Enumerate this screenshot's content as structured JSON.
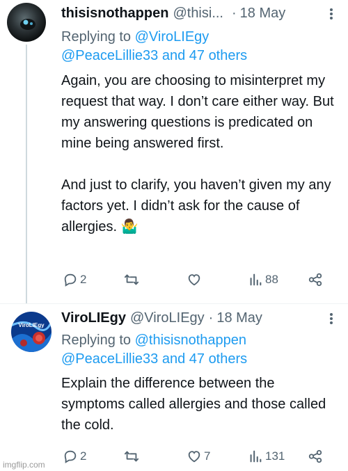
{
  "tweets": [
    {
      "display_name": "thisisnothappen",
      "handle": "@thisi...",
      "date": "18 May",
      "replying_prefix": "Replying to",
      "replying_to_first": "@ViroLIEgy",
      "replying_to_rest": "@PeaceLillie33 and 47 others",
      "body_paragraph_1": "Again, you are choosing to misinterpret my request that way. I don’t care either way. But my answering questions is predicated on mine being answered first.",
      "body_paragraph_2": "And just to clarify, you haven’t given my any factors yet. I didn’t ask for the cause of allergies. 🤷‍♂️",
      "replies": "2",
      "retweets": "",
      "likes": "",
      "views": "88"
    },
    {
      "display_name": "ViroLIEgy",
      "handle": "@ViroLIEgy",
      "date": "18 May",
      "avatar_text": "ViroLIEgy",
      "replying_prefix": "Replying to",
      "replying_to_first": "@thisisnothappen",
      "replying_to_rest": "@PeaceLillie33 and 47 others",
      "body_paragraph_1": "Explain the difference between the symptoms called allergies and those called the cold.",
      "replies": "2",
      "retweets": "",
      "likes": "7",
      "views": "131"
    }
  ],
  "separator_dot": "·",
  "watermark": "imgflip.com",
  "colors": {
    "link": "#1d9bf0",
    "secondary_text": "#536471",
    "primary_text": "#0f1419",
    "thread_line": "#cfd9de"
  },
  "icons": [
    "reply-icon",
    "retweet-icon",
    "like-icon",
    "views-icon",
    "share-icon",
    "more-icon"
  ]
}
